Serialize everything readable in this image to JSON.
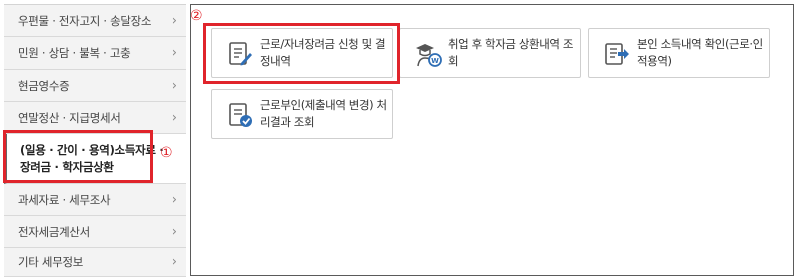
{
  "sidebar": {
    "items": [
      {
        "label": "우편물 · 전자고지 · 송달장소"
      },
      {
        "label": "민원 · 상담 · 불복 · 고충"
      },
      {
        "label": "현금영수증"
      },
      {
        "label": "연말정산 · 지급명세서"
      },
      {
        "label": "(일용 · 간이 · 용역)소득자료 · 장려금 · 학자금상환"
      },
      {
        "label": "과세자료 · 세무조사"
      },
      {
        "label": "전자세금계산서"
      },
      {
        "label": "기타 세무정보"
      }
    ],
    "chevron": "›"
  },
  "markers": {
    "one": "①",
    "two": "②"
  },
  "cards": [
    {
      "label": "근로/자녀장려금 신청 및 결정내역",
      "icon": "document-pen-icon"
    },
    {
      "label": "취업 후 학자금 상환내역 조회",
      "icon": "graduate-coin-icon"
    },
    {
      "label": "본인 소득내역 확인(근로·인적용역)",
      "icon": "document-arrow-icon"
    },
    {
      "label": "근로부인(제출내역 변경) 처리결과 조회",
      "icon": "document-check-icon"
    }
  ],
  "colors": {
    "highlight": "#e0242b",
    "icon_accent": "#2f6eb5"
  }
}
